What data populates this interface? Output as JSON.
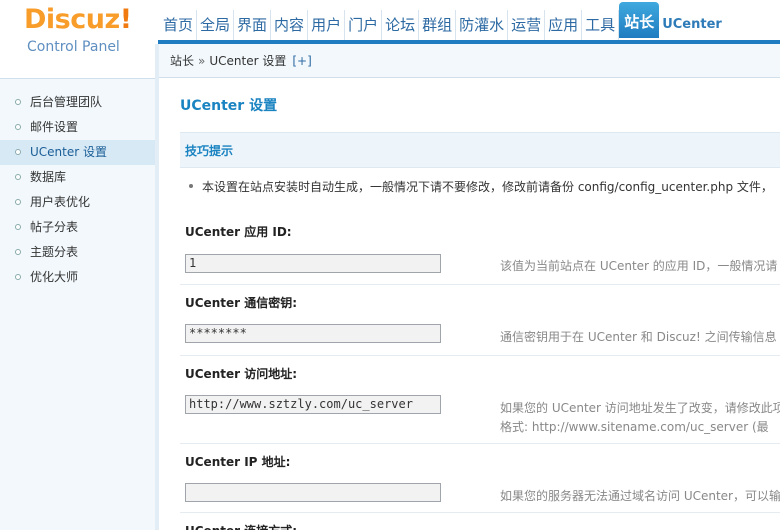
{
  "logo": {
    "brand": "Discuz",
    "excl": "!",
    "sub": "Control Panel"
  },
  "nav": {
    "items": [
      "首页",
      "全局",
      "界面",
      "内容",
      "用户",
      "门户",
      "论坛",
      "群组",
      "防灌水",
      "运营",
      "应用",
      "工具",
      "站长",
      "UCenter"
    ],
    "active_index": 12
  },
  "breadcrumb": {
    "home": "站长",
    "sep": "»",
    "current": "UCenter 设置",
    "plus": "[+]"
  },
  "sidebar": {
    "items": [
      "后台管理团队",
      "邮件设置",
      "UCenter 设置",
      "数据库",
      "用户表优化",
      "帖子分表",
      "主题分表",
      "优化大师"
    ],
    "active_index": 2
  },
  "main": {
    "title": "UCenter 设置",
    "tip_header": "技巧提示",
    "tip_text": "本设置在站点安装时自动生成，一般情况下请不要修改，修改前请备份 config/config_ucenter.php 文件，",
    "fields": [
      {
        "label": "UCenter 应用 ID:",
        "value": "1",
        "desc": "该值为当前站点在 UCenter 的应用 ID，一般情况请"
      },
      {
        "label": "UCenter 通信密钥:",
        "value": "********",
        "desc": "通信密钥用于在 UCenter 和 Discuz! 之间传输信息"
      },
      {
        "label": "UCenter 访问地址:",
        "value": "http://www.sztzly.com/uc_server",
        "desc": "如果您的 UCenter 访问地址发生了改变，请修改此项",
        "desc2": "格式: http://www.sitename.com/uc_server (最"
      },
      {
        "label": "UCenter IP 地址:",
        "value": "",
        "desc": "如果您的服务器无法通过域名访问 UCenter，可以输"
      },
      {
        "label": "UCenter 连接方式:"
      }
    ]
  },
  "colors": {
    "accent": "#1f7cc0",
    "logo": "#f89c2a",
    "title": "#1a83c1"
  }
}
